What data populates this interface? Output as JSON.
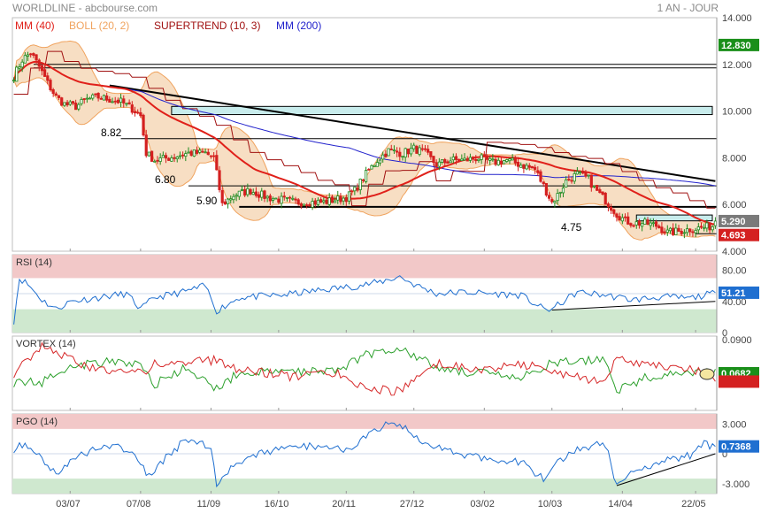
{
  "header": {
    "title": "WORLDLINE - abcbourse.com",
    "period": "1 AN - JOUR"
  },
  "colors": {
    "price": "#1f8a1f",
    "mm40": "#e0201a",
    "boll_fill": "#f6d8b8",
    "boll_line": "#f0a35e",
    "supertrend": "#a01010",
    "mm200": "#2222cc",
    "trendline": "#000000",
    "zone_fill": "#c8ecec",
    "rsi": "#1f6fd0",
    "vortex_plus": "#2ca02c",
    "vortex_minus": "#d62728",
    "pgo": "#1f6fd0",
    "over_zone": "#f2c8c8",
    "under_zone": "#cfe8cf",
    "badge_green": "#1a8f1a",
    "badge_blue": "#1f6fd0",
    "badge_red": "#d42020",
    "badge_gray": "#7a7a7a"
  },
  "chart_data": [
    {
      "type": "candlestick",
      "name": "price",
      "legend": [
        {
          "text": "MM (40)",
          "color": "#e0201a"
        },
        {
          "text": "BOLL (20, 2)",
          "color": "#f0a35e"
        },
        {
          "text": "SUPERTREND (10, 3)",
          "color": "#a01010"
        },
        {
          "text": "MM (200)",
          "color": "#2222cc"
        }
      ],
      "ylim": [
        4.0,
        14.0
      ],
      "y_ticks": [
        {
          "v": 14,
          "label": "14.000"
        },
        {
          "v": 12,
          "label": "12.000"
        },
        {
          "v": 10,
          "label": "10.000"
        },
        {
          "v": 8,
          "label": "8.000"
        },
        {
          "v": 6,
          "label": "6.000"
        },
        {
          "v": 4,
          "label": "4.000"
        }
      ],
      "x_ticks": [
        {
          "i": 20,
          "label": "03/07"
        },
        {
          "i": 45,
          "label": "07/08"
        },
        {
          "i": 70,
          "label": "11/09"
        },
        {
          "i": 94,
          "label": "16/10"
        },
        {
          "i": 118,
          "label": "20/11"
        },
        {
          "i": 142,
          "label": "27/12"
        },
        {
          "i": 167,
          "label": "03/02"
        },
        {
          "i": 191,
          "label": "10/03"
        },
        {
          "i": 216,
          "label": "14/04"
        },
        {
          "i": 242,
          "label": "22/05"
        }
      ],
      "n_points": 250,
      "anchors": [
        [
          0,
          11.5
        ],
        [
          3,
          12.2
        ],
        [
          6,
          12.5
        ],
        [
          9,
          11.9
        ],
        [
          12,
          11.2
        ],
        [
          15,
          10.6
        ],
        [
          18,
          10.3
        ],
        [
          22,
          10.2
        ],
        [
          26,
          10.5
        ],
        [
          30,
          10.6
        ],
        [
          34,
          10.5
        ],
        [
          38,
          10.4
        ],
        [
          42,
          10.1
        ],
        [
          45,
          9.8
        ],
        [
          47,
          8.2
        ],
        [
          50,
          7.9
        ],
        [
          55,
          8.0
        ],
        [
          62,
          8.2
        ],
        [
          68,
          8.2
        ],
        [
          71,
          8.0
        ],
        [
          74,
          6.0
        ],
        [
          78,
          6.4
        ],
        [
          84,
          6.6
        ],
        [
          90,
          6.3
        ],
        [
          100,
          6.1
        ],
        [
          110,
          6.1
        ],
        [
          118,
          6.3
        ],
        [
          121,
          6.6
        ],
        [
          125,
          7.3
        ],
        [
          129,
          7.9
        ],
        [
          133,
          8.3
        ],
        [
          138,
          8.2
        ],
        [
          142,
          8.4
        ],
        [
          146,
          8.2
        ],
        [
          150,
          7.7
        ],
        [
          155,
          7.9
        ],
        [
          160,
          7.9
        ],
        [
          165,
          8.0
        ],
        [
          170,
          7.8
        ],
        [
          175,
          7.9
        ],
        [
          180,
          7.7
        ],
        [
          185,
          7.5
        ],
        [
          188,
          6.8
        ],
        [
          191,
          6.1
        ],
        [
          193,
          6.4
        ],
        [
          196,
          7.0
        ],
        [
          200,
          7.3
        ],
        [
          204,
          7.1
        ],
        [
          206,
          6.7
        ],
        [
          209,
          6.3
        ],
        [
          212,
          5.9
        ],
        [
          214,
          5.6
        ],
        [
          217,
          5.3
        ],
        [
          220,
          5.2
        ],
        [
          224,
          5.2
        ],
        [
          228,
          5.1
        ],
        [
          232,
          4.8
        ],
        [
          236,
          4.85
        ],
        [
          240,
          4.95
        ],
        [
          244,
          5.0
        ],
        [
          249,
          5.1
        ]
      ],
      "last_close": 5.29,
      "resistance_levels": [
        {
          "v": 8.82,
          "label": "8.82",
          "from_i": 38
        },
        {
          "v": 6.8,
          "label": "6.80",
          "from_i": 62
        },
        {
          "v": 5.9,
          "label": "5.90",
          "from_i": 80
        },
        {
          "v": 4.75,
          "label": "4.75",
          "from_i": 242
        }
      ],
      "long_levels": [
        12.0,
        11.85
      ],
      "zones": [
        {
          "y1": 10.2,
          "y2": 9.85,
          "from_i": 56
        },
        {
          "y1": 5.55,
          "y2": 5.3,
          "from_i": 221
        }
      ],
      "downtrend": [
        [
          34,
          11.1
        ],
        [
          249,
          7.0
        ]
      ],
      "price_badges": [
        {
          "v": 12.83,
          "label": "12.830",
          "color": "#1a8f1a"
        },
        {
          "v": 5.29,
          "label": "5.290",
          "color": "#7a7a7a"
        },
        {
          "v": 4.693,
          "label": "4.693",
          "color": "#d42020"
        }
      ]
    },
    {
      "type": "line",
      "name": "RSI (14)",
      "ylim": [
        0,
        100
      ],
      "y_ticks": [
        {
          "v": 80,
          "label": "80.00"
        },
        {
          "v": 40,
          "label": "40.00"
        },
        {
          "v": 0,
          "label": "0"
        }
      ],
      "upper_band": [
        70,
        100
      ],
      "lower_band": [
        0,
        30
      ],
      "mid_line": 50,
      "anchors": [
        [
          0,
          15
        ],
        [
          2,
          70
        ],
        [
          5,
          62
        ],
        [
          10,
          42
        ],
        [
          15,
          30
        ],
        [
          20,
          40
        ],
        [
          30,
          45
        ],
        [
          40,
          50
        ],
        [
          45,
          30
        ],
        [
          50,
          45
        ],
        [
          60,
          52
        ],
        [
          68,
          60
        ],
        [
          72,
          28
        ],
        [
          80,
          45
        ],
        [
          95,
          48
        ],
        [
          110,
          55
        ],
        [
          122,
          60
        ],
        [
          130,
          65
        ],
        [
          137,
          72
        ],
        [
          142,
          62
        ],
        [
          150,
          50
        ],
        [
          160,
          52
        ],
        [
          170,
          50
        ],
        [
          180,
          48
        ],
        [
          188,
          30
        ],
        [
          191,
          30
        ],
        [
          200,
          52
        ],
        [
          210,
          48
        ],
        [
          220,
          42
        ],
        [
          230,
          46
        ],
        [
          240,
          44
        ],
        [
          249,
          51
        ]
      ],
      "support": [
        [
          191,
          29
        ],
        [
          249,
          40
        ]
      ],
      "last": 51.21,
      "badge": {
        "label": "51.21",
        "color": "#1f6fd0"
      }
    },
    {
      "type": "line",
      "name": "VORTEX (14)",
      "ylim": [
        -0.2,
        0.2
      ],
      "y_ticks": [
        {
          "v": 0.18,
          "label": "0.0900"
        }
      ],
      "series": [
        {
          "name": "VI+",
          "anchors": [
            [
              0,
              -0.05
            ],
            [
              10,
              -0.05
            ],
            [
              16,
              0.02
            ],
            [
              30,
              0.06
            ],
            [
              45,
              0.05
            ],
            [
              50,
              -0.06
            ],
            [
              60,
              0.02
            ],
            [
              72,
              -0.08
            ],
            [
              80,
              0.0
            ],
            [
              100,
              0.01
            ],
            [
              115,
              0.02
            ],
            [
              125,
              0.1
            ],
            [
              137,
              0.14
            ],
            [
              150,
              0.03
            ],
            [
              165,
              0.0
            ],
            [
              180,
              -0.03
            ],
            [
              190,
              0.05
            ],
            [
              210,
              0.08
            ],
            [
              214,
              -0.09
            ],
            [
              225,
              -0.02
            ],
            [
              240,
              0.0
            ],
            [
              249,
              0.0
            ]
          ]
        },
        {
          "name": "VI-",
          "anchors": [
            [
              0,
              0.0
            ],
            [
              10,
              0.14
            ],
            [
              16,
              0.1
            ],
            [
              30,
              0.02
            ],
            [
              45,
              0.0
            ],
            [
              50,
              0.05
            ],
            [
              60,
              0.06
            ],
            [
              72,
              0.07
            ],
            [
              80,
              0.02
            ],
            [
              100,
              -0.02
            ],
            [
              115,
              0.0
            ],
            [
              125,
              -0.08
            ],
            [
              137,
              -0.1
            ],
            [
              150,
              0.05
            ],
            [
              165,
              0.02
            ],
            [
              180,
              0.05
            ],
            [
              190,
              0.02
            ],
            [
              210,
              -0.06
            ],
            [
              214,
              0.08
            ],
            [
              225,
              0.05
            ],
            [
              240,
              0.02
            ],
            [
              249,
              -0.02
            ]
          ]
        }
      ],
      "badges": [
        {
          "v": 0.0,
          "label": "0.0682",
          "color": "#1a8f1a"
        },
        {
          "v": -0.045,
          "label": "",
          "color": "#d42020"
        }
      ]
    },
    {
      "type": "line",
      "name": "PGO (14)",
      "ylim": [
        -4.0,
        4.0
      ],
      "y_ticks": [
        {
          "v": 3,
          "label": "3.000"
        },
        {
          "v": 0,
          "label": "0"
        },
        {
          "v": -3,
          "label": "-3.000"
        }
      ],
      "upper_band": [
        2.5,
        4.0
      ],
      "lower_band": [
        -4.0,
        -2.5
      ],
      "anchors": [
        [
          0,
          0.5
        ],
        [
          4,
          1.0
        ],
        [
          10,
          -0.5
        ],
        [
          15,
          -2.0
        ],
        [
          20,
          -0.8
        ],
        [
          30,
          0.8
        ],
        [
          40,
          0.5
        ],
        [
          45,
          -1.0
        ],
        [
          48,
          -2.4
        ],
        [
          55,
          0.0
        ],
        [
          62,
          1.5
        ],
        [
          70,
          0.5
        ],
        [
          72,
          -3.0
        ],
        [
          78,
          -1.0
        ],
        [
          90,
          0.2
        ],
        [
          105,
          0.8
        ],
        [
          118,
          0.5
        ],
        [
          126,
          1.8
        ],
        [
          133,
          3.0
        ],
        [
          139,
          2.5
        ],
        [
          145,
          1.0
        ],
        [
          150,
          0.8
        ],
        [
          160,
          -0.2
        ],
        [
          170,
          -0.5
        ],
        [
          180,
          -0.8
        ],
        [
          188,
          -2.6
        ],
        [
          193,
          -1.0
        ],
        [
          200,
          0.5
        ],
        [
          210,
          1.0
        ],
        [
          214,
          -3.2
        ],
        [
          220,
          -1.6
        ],
        [
          230,
          -0.8
        ],
        [
          240,
          -0.2
        ],
        [
          244,
          1.0
        ],
        [
          249,
          0.7
        ]
      ],
      "support": [
        [
          214,
          -3.2
        ],
        [
          249,
          0.0
        ]
      ],
      "last": 0.7368,
      "badge": {
        "label": "0.7368",
        "color": "#1f6fd0"
      }
    }
  ]
}
